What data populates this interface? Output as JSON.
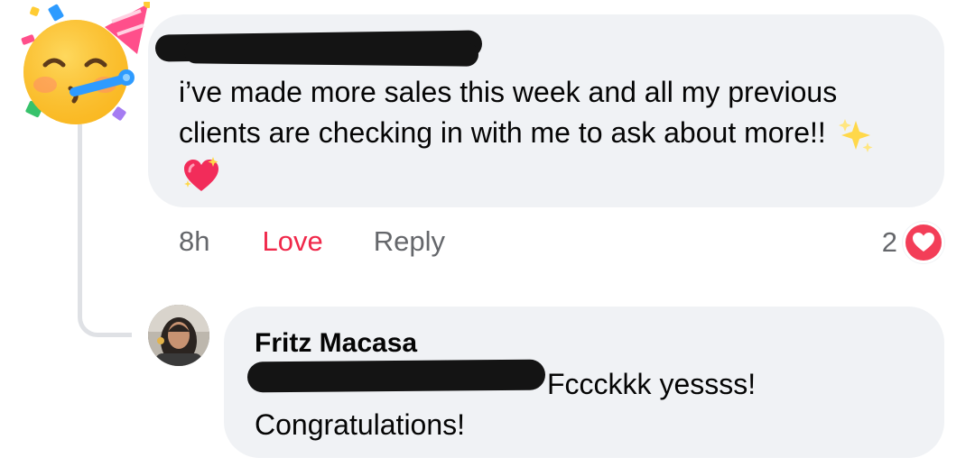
{
  "comment": {
    "author_name": "",
    "text": "i’ve made more sales this week and all my previous clients are checking in with me to ask about more!!",
    "emoji": [
      "sparkles",
      "sparkling-heart"
    ],
    "time": "8h",
    "love_label": "Love",
    "reply_label": "Reply",
    "reaction_count": "2",
    "reaction_type": "heart-icon",
    "avatar": "partying-face-icon"
  },
  "reply": {
    "author_name": "Fritz Macasa",
    "text_line1": "Fccckkk yessss!",
    "text_line2": "Congratulations!"
  },
  "colors": {
    "bubble": "#f0f2f5",
    "love": "#f0284a",
    "meta": "#65676b",
    "reaction_heart": "#f33e58",
    "thread_line": "#dfe1e5"
  }
}
